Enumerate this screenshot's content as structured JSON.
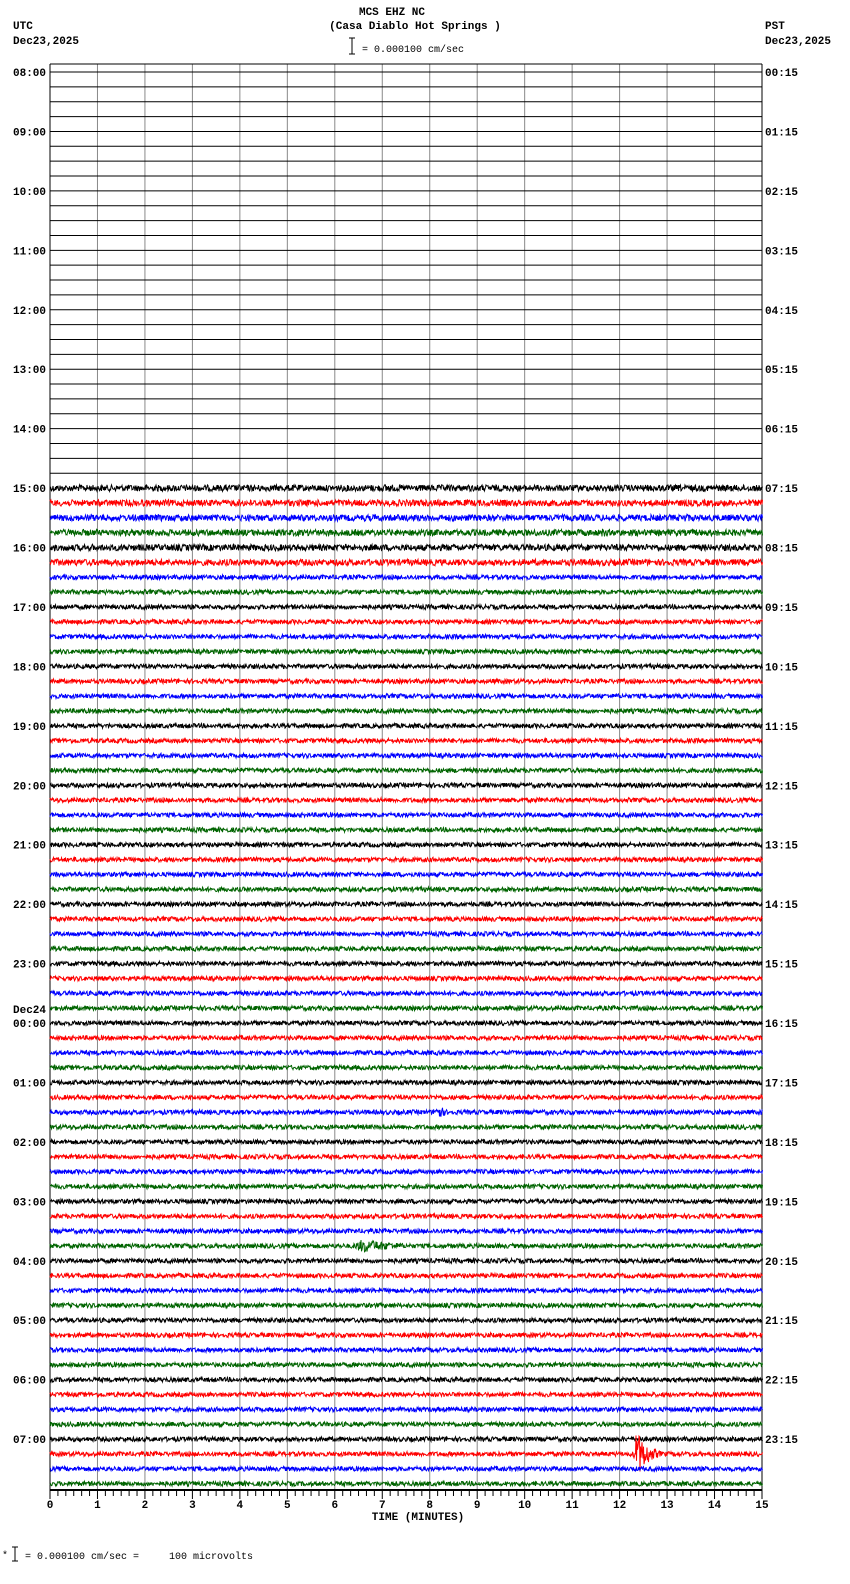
{
  "header": {
    "title": "MCS EHZ NC",
    "subtitle": "(Casa Diablo Hot Springs )",
    "left_tz": "UTC",
    "left_date": "Dec23,2025",
    "right_tz": "PST",
    "right_date": "Dec23,2025",
    "scale_text": "= 0.000100 cm/sec"
  },
  "footer": {
    "scale_text": "= 0.000100 cm/sec =     100 microvolts"
  },
  "chart_data": {
    "type": "helicorder",
    "title": "MCS EHZ NC",
    "xlabel": "TIME (MINUTES)",
    "xlim": [
      0,
      15
    ],
    "x_ticks": [
      "0",
      "1",
      "2",
      "3",
      "4",
      "5",
      "6",
      "7",
      "8",
      "9",
      "10",
      "11",
      "12",
      "13",
      "14",
      "15"
    ],
    "left_labels": [
      "08:00",
      "09:00",
      "10:00",
      "11:00",
      "12:00",
      "13:00",
      "14:00",
      "15:00",
      "16:00",
      "17:00",
      "18:00",
      "19:00",
      "20:00",
      "21:00",
      "22:00",
      "23:00",
      "00:00",
      "01:00",
      "02:00",
      "03:00",
      "04:00",
      "05:00",
      "06:00",
      "07:00"
    ],
    "left_date_change": {
      "hour_index": 16,
      "label": "Dec24"
    },
    "right_labels": [
      "00:15",
      "01:15",
      "02:15",
      "03:15",
      "04:15",
      "05:15",
      "06:15",
      "07:15",
      "08:15",
      "09:15",
      "10:15",
      "11:15",
      "12:15",
      "13:15",
      "14:15",
      "15:15",
      "16:15",
      "17:15",
      "18:15",
      "19:15",
      "20:15",
      "21:15",
      "22:15",
      "23:15"
    ],
    "traces_per_hour": 4,
    "minutes_per_trace": 15,
    "first_data_hour_index": 7,
    "trace_colors": [
      "#000000",
      "#ff0000",
      "#0000ff",
      "#006400"
    ],
    "no_data_color": "#000000",
    "events": [
      {
        "hour_index": 7,
        "trace": 0,
        "start_min": 7.0,
        "end_min": 8.0,
        "amplitude": 2
      },
      {
        "hour_index": 7,
        "trace": 2,
        "start_min": 13.3,
        "end_min": 14.2,
        "amplitude": 2
      },
      {
        "hour_index": 7,
        "trace": 3,
        "start_min": 11.5,
        "end_min": 12.8,
        "amplitude": 1.8
      },
      {
        "hour_index": 17,
        "trace": 2,
        "start_min": 8.1,
        "end_min": 8.6,
        "amplitude": 5
      },
      {
        "hour_index": 19,
        "trace": 3,
        "start_min": 6.4,
        "end_min": 8.8,
        "amplitude": 4
      },
      {
        "hour_index": 23,
        "trace": 1,
        "start_min": 12.3,
        "end_min": 13.0,
        "amplitude": 14
      }
    ]
  }
}
